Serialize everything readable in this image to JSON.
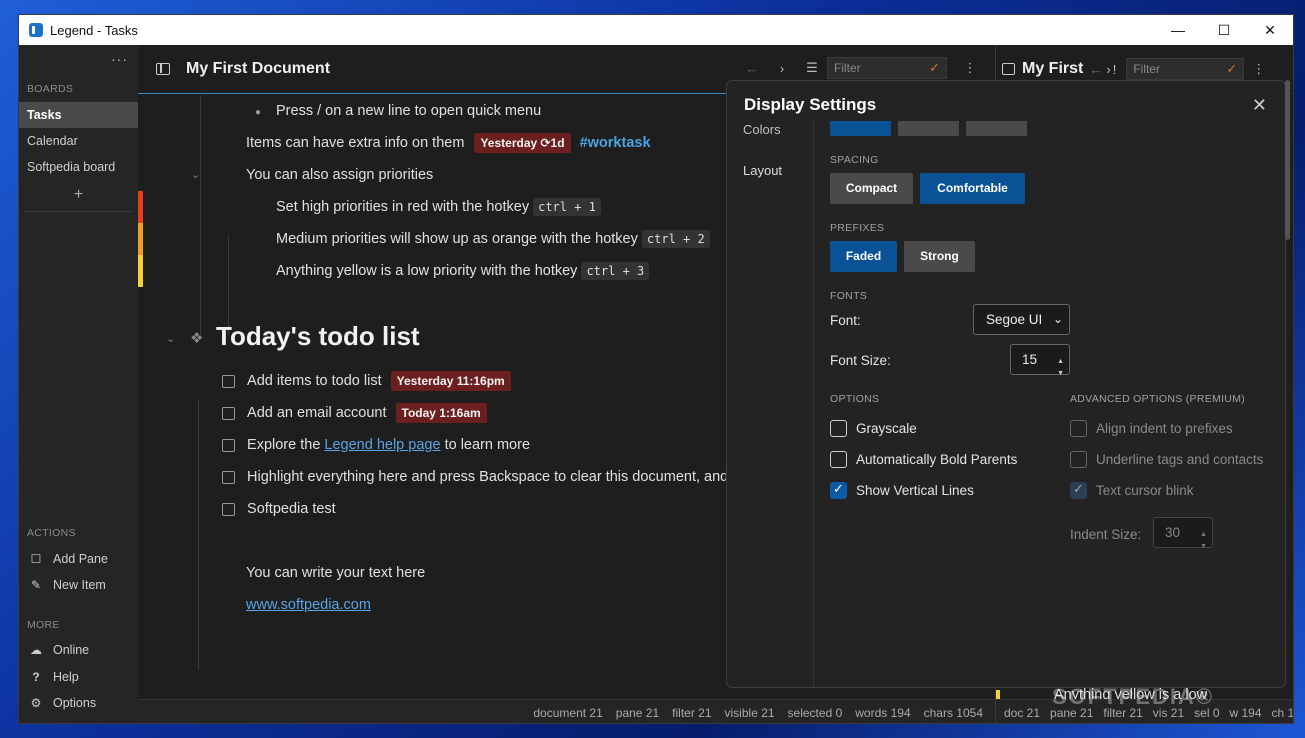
{
  "window": {
    "title": "Legend - Tasks",
    "minimize": "—",
    "maximize": "☐",
    "close": "✕"
  },
  "sidebar": {
    "menu": "···",
    "boards_heading": "BOARDS",
    "boards": [
      "Tasks",
      "Calendar",
      "Softpedia board"
    ],
    "add": "+",
    "actions_heading": "ACTIONS",
    "actions": [
      {
        "icon": "square-icon",
        "label": "Add Pane"
      },
      {
        "icon": "pencil-icon",
        "label": "New Item"
      }
    ],
    "more_heading": "MORE",
    "more": [
      {
        "icon": "cloud-icon",
        "label": "Online"
      },
      {
        "icon": "question-icon",
        "label": "Help"
      },
      {
        "icon": "gear-icon",
        "label": "Options"
      }
    ]
  },
  "pane": {
    "title": "My First Document",
    "filter_placeholder": "Filter",
    "status": [
      "document 21",
      "pane 21",
      "filter 21",
      "visible 21",
      "selected 0",
      "words 194",
      "chars 1054"
    ]
  },
  "doc": {
    "line1": "Press / on a new line to open quick menu",
    "line2": "Items can have extra info on them",
    "line2_tag": "Yesterday ⟳1d",
    "line2_hashtag": "#worktask",
    "line3": "You can also assign priorities",
    "line4": "Set high priorities in red with the hotkey",
    "line4_key": "ctrl + 1",
    "line5": "Medium priorities will show up as orange with the hotkey",
    "line5_key": "ctrl + 2",
    "line6": "Anything yellow is a low priority with the hotkey",
    "line6_key": "ctrl + 3",
    "heading": "Today's todo list",
    "todo1": "Add items to todo list",
    "todo1_tag": "Yesterday 11:16pm",
    "todo2": "Add an email account",
    "todo2_tag": "Today 1:16am",
    "todo3_pre": "Explore the",
    "todo3_link": "Legend help page",
    "todo3_post": "to learn more",
    "todo4": "Highlight everything here and press Backspace to clear this document, and",
    "todo5": "Softpedia test",
    "text1": "You can write your text here",
    "text2": "www.softpedia.com"
  },
  "right_pane": {
    "title": "My First",
    "filter_placeholder": "Filter",
    "status": [
      "doc 21",
      "pane 21",
      "filter 21",
      "vis 21",
      "sel 0",
      "w 194",
      "ch 1"
    ],
    "peek_text": "Anything yellow is a low"
  },
  "settings": {
    "title": "Display Settings",
    "close": "✕",
    "nav": [
      "Colors",
      "Layout"
    ],
    "spacing_label": "SPACING",
    "spacing": [
      "Compact",
      "Comfortable"
    ],
    "prefixes_label": "PREFIXES",
    "prefixes": [
      "Faded",
      "Strong"
    ],
    "fonts_label": "FONTS",
    "font_label": "Font:",
    "font_value": "Segoe UI",
    "font_size_label": "Font Size:",
    "font_size_value": "15",
    "options_label": "OPTIONS",
    "options": [
      {
        "label": "Grayscale",
        "checked": false
      },
      {
        "label": "Automatically Bold Parents",
        "checked": false
      },
      {
        "label": "Show Vertical Lines",
        "checked": true
      }
    ],
    "advanced_label": "ADVANCED OPTIONS (PREMIUM)",
    "advanced": [
      {
        "label": "Align indent to prefixes",
        "checked": false
      },
      {
        "label": "Underline tags and contacts",
        "checked": false
      },
      {
        "label": "Text cursor blink",
        "checked": true
      }
    ],
    "indent_label": "Indent Size:",
    "indent_value": "30"
  },
  "colors": {
    "accent": "#0a5296",
    "high": "#e8401c",
    "medium": "#f0a020",
    "low": "#f2d23a",
    "tag": "#6b1f1f"
  },
  "watermark": "SOFTPEDIA®"
}
